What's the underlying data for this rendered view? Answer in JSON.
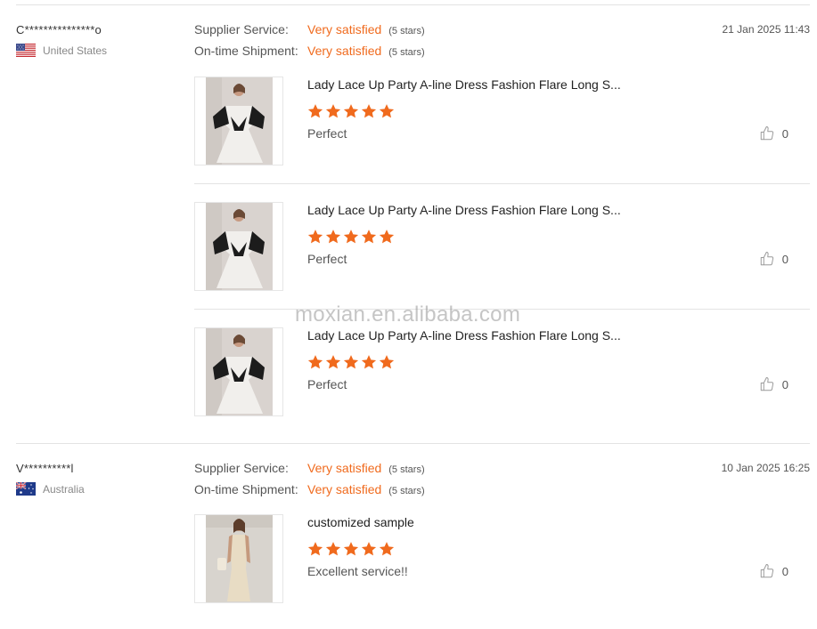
{
  "reviews": [
    {
      "name": "C***************o",
      "country": "United States",
      "flag_icon": "us-flag-icon",
      "date": "21 Jan 2025 11:43",
      "ratings": [
        {
          "label": "Supplier Service:",
          "value": "Very satisfied",
          "stars_text": "(5 stars)"
        },
        {
          "label": "On-time Shipment:",
          "value": "Very satisfied",
          "stars_text": "(5 stars)"
        }
      ],
      "items": [
        {
          "title": "Lady Lace Up Party A-line Dress Fashion Flare Long S...",
          "stars": 5,
          "comment": "Perfect",
          "likes": "0"
        },
        {
          "title": "Lady Lace Up Party A-line Dress Fashion Flare Long S...",
          "stars": 5,
          "comment": "Perfect",
          "likes": "0"
        },
        {
          "title": "Lady Lace Up Party A-line Dress Fashion Flare Long S...",
          "stars": 5,
          "comment": "Perfect",
          "likes": "0"
        }
      ]
    },
    {
      "name": "V**********l",
      "country": "Australia",
      "flag_icon": "au-flag-icon",
      "date": "10 Jan 2025 16:25",
      "ratings": [
        {
          "label": "Supplier Service:",
          "value": "Very satisfied",
          "stars_text": "(5 stars)"
        },
        {
          "label": "On-time Shipment:",
          "value": "Very satisfied",
          "stars_text": "(5 stars)"
        }
      ],
      "items": [
        {
          "title": "customized sample",
          "stars": 5,
          "comment": "Excellent service!!",
          "likes": "0"
        }
      ]
    }
  ],
  "watermark": "moxian.en.alibaba.com",
  "colors": {
    "accent": "#f06a1d",
    "star": "#f06a1d",
    "divider": "#e3e3e3"
  }
}
